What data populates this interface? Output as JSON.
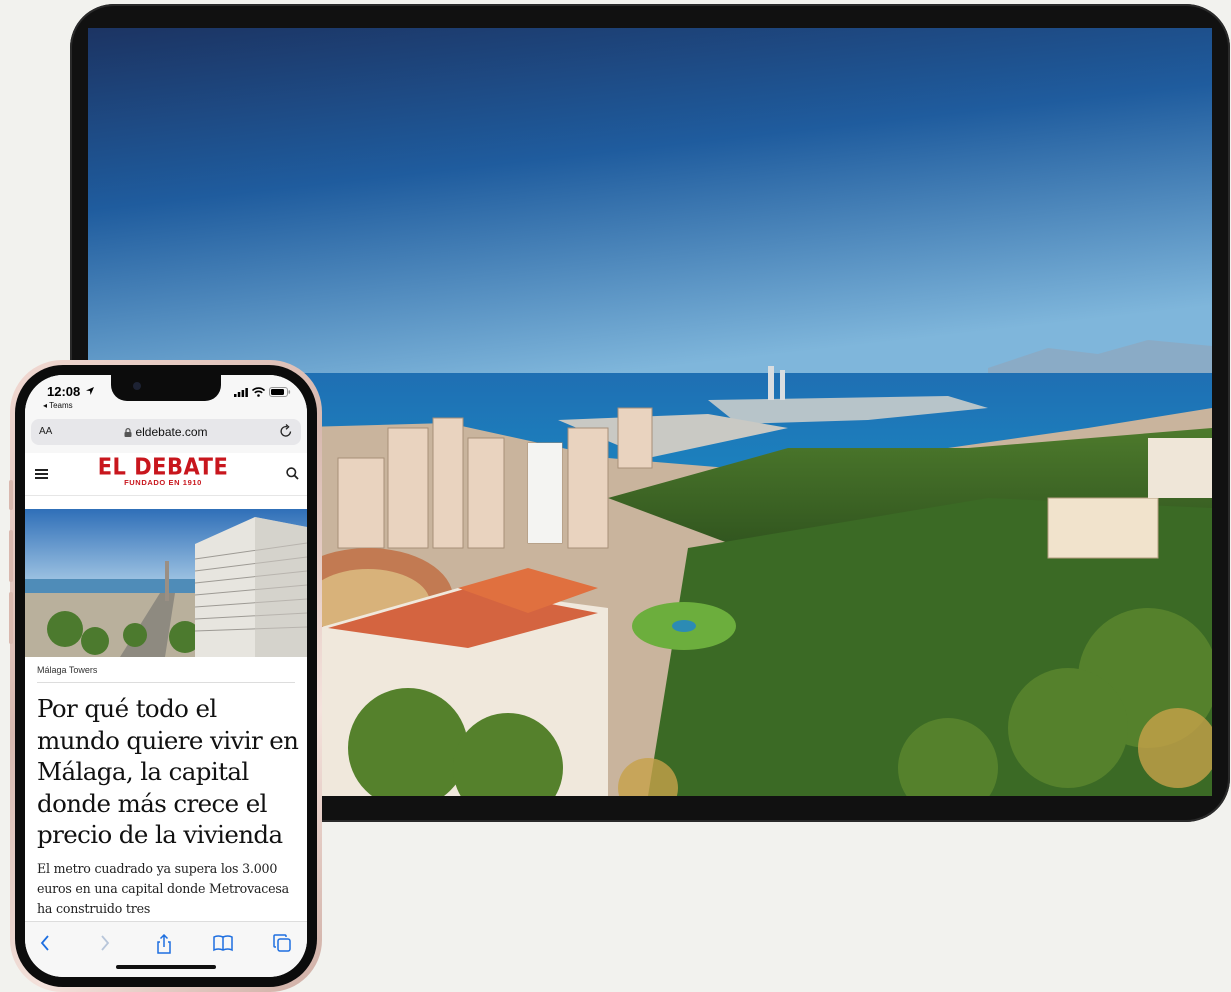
{
  "phone": {
    "status_bar": {
      "time": "12:08",
      "back_app": "◂ Teams"
    },
    "browser": {
      "text_size_button": "AA",
      "lock_glyph": "🔒",
      "url": "eldebate.com"
    },
    "site": {
      "logo": "EL DEBATE",
      "tagline": "FUNDADO EN 1910"
    },
    "article": {
      "image_caption": "Málaga Towers",
      "headline": "Por qué todo el mundo quiere vivir en Málaga, la capital donde más crece el precio de la vivienda",
      "lede": "El metro cuadrado ya supera los 3.000 euros en una capital donde Metrovacesa ha construido tres"
    },
    "toolbar": {
      "icons": [
        "back-icon",
        "forward-icon",
        "share-icon",
        "bookmarks-icon",
        "tabs-icon"
      ]
    }
  },
  "tablet": {
    "screen_image": "Aerial view of Málaga city, port and sea under blue sky"
  },
  "colors": {
    "brand_red": "#c8161d",
    "ios_blue": "#1e6fe0",
    "background": "#f2f2ee"
  }
}
